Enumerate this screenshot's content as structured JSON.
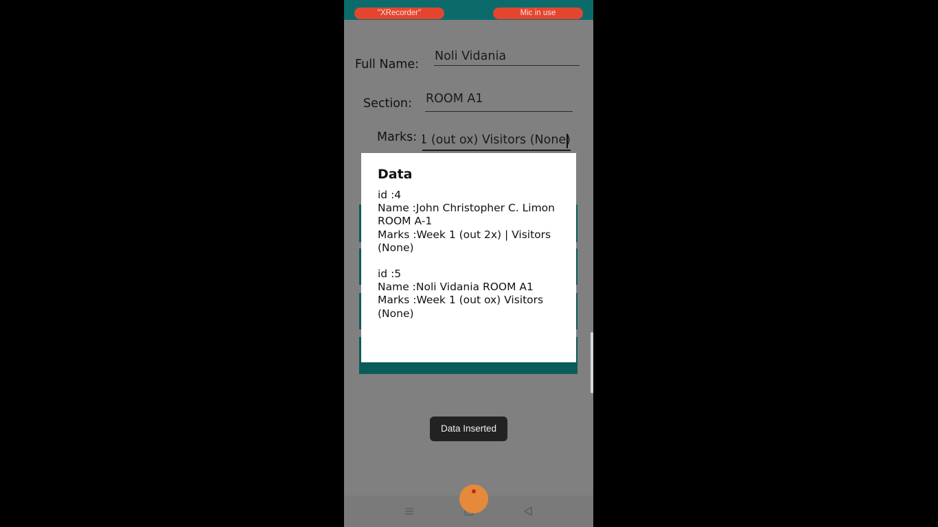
{
  "status_bar": {
    "recorder_pill": "\"XRecorder\"",
    "mic_pill": "Mic in use"
  },
  "form": {
    "full_name_label": "Full Name:",
    "full_name_value": "Noli Vidania",
    "section_label": "Section:",
    "section_value": "ROOM A1",
    "marks_label": "Marks:",
    "marks_value": "‹ 1 (out ox) Visitors (None)"
  },
  "dialog": {
    "title": "Data",
    "records": [
      {
        "id": "id :4",
        "name": "Name :John Christopher C. Limon ROOM A-1",
        "marks": "Marks :Week 1 (out 2x) | Visitors (None)"
      },
      {
        "id": "id :5",
        "name": "Name :Noli Vidania  ROOM A1",
        "marks": "Marks :Week 1 (out ox) Visitors (None)"
      }
    ]
  },
  "toast": "Data Inserted",
  "colors": {
    "status_bar": "#0b6b6b",
    "pill": "#e5452f",
    "button": "#0b5b5b",
    "scrim": "#808080"
  },
  "nav_icons": [
    "menu-icon",
    "home-square-icon",
    "back-triangle-icon"
  ]
}
